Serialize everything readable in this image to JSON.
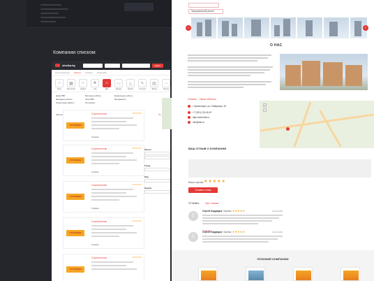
{
  "section_title": "Компании списком",
  "left": {
    "logo": "stroika.by",
    "header_search_btn": "Найти",
    "tabs": [
      "Строительство",
      "Ремонт",
      "Каталог",
      "Компании"
    ],
    "categories": [
      "Вода",
      "Материалы",
      "Гаражи",
      "Сад",
      "Дом",
      "Дерево",
      "Кровля",
      "Отделка",
      "Фасад",
      "Прочее"
    ],
    "subcategories": [
      "Дома ПВХ",
      "Бетонные работы",
      "Кровельные работы",
      "Фасадные работы",
      "Окна ПВХ",
      "Фундаменты",
      "Отделочные работы",
      "Отопление"
    ],
    "list_left": "Запрошенные результаты",
    "list_right": "По дате",
    "company_name": "Строительство",
    "company_logo": "СТРОЙДОМ",
    "rating": "★★★★★",
    "phone": "Телефон",
    "filters": [
      "Регион",
      "Город",
      "Вид",
      "Оценка"
    ]
  },
  "right": {
    "pill": "Загруженный регист",
    "about_title": "О НАС",
    "links": [
      "Отзывы",
      "Наши объекты"
    ],
    "contacts": [
      "г. Красноярск, ул. Сибирская, 18",
      "+7 (391) 123-45-67",
      "http://www.site.ru",
      "info@site.ru"
    ],
    "review_title": "ВАШ ОТЗЫВ О КОМПАНИИ",
    "rate_label": "Ваша оценка:",
    "rate_stars": "★★★★★",
    "send_btn": "Оставить отзыв",
    "reviews_label": "ОТЗЫВЫ",
    "reviews_link": "Все отзывы",
    "reviews": [
      {
        "name": "Сергей Кордзадзе",
        "score": "Оценка:",
        "stars": "★★★★★",
        "date": "14.02.2016",
        "avatar": "С",
        "reply": "Ответить"
      },
      {
        "name": "Сергей Кордзадзе",
        "score": "Оценка:",
        "stars": "★★★★★",
        "date": "14.02.2016",
        "avatar": "С",
        "reply": "Ответить"
      }
    ],
    "similar_title": "ПОХОЖИЕ КОМПАНИИ"
  },
  "colors": {
    "accent": "#e53935",
    "star": "#f5a623",
    "dark": "#24262c"
  }
}
